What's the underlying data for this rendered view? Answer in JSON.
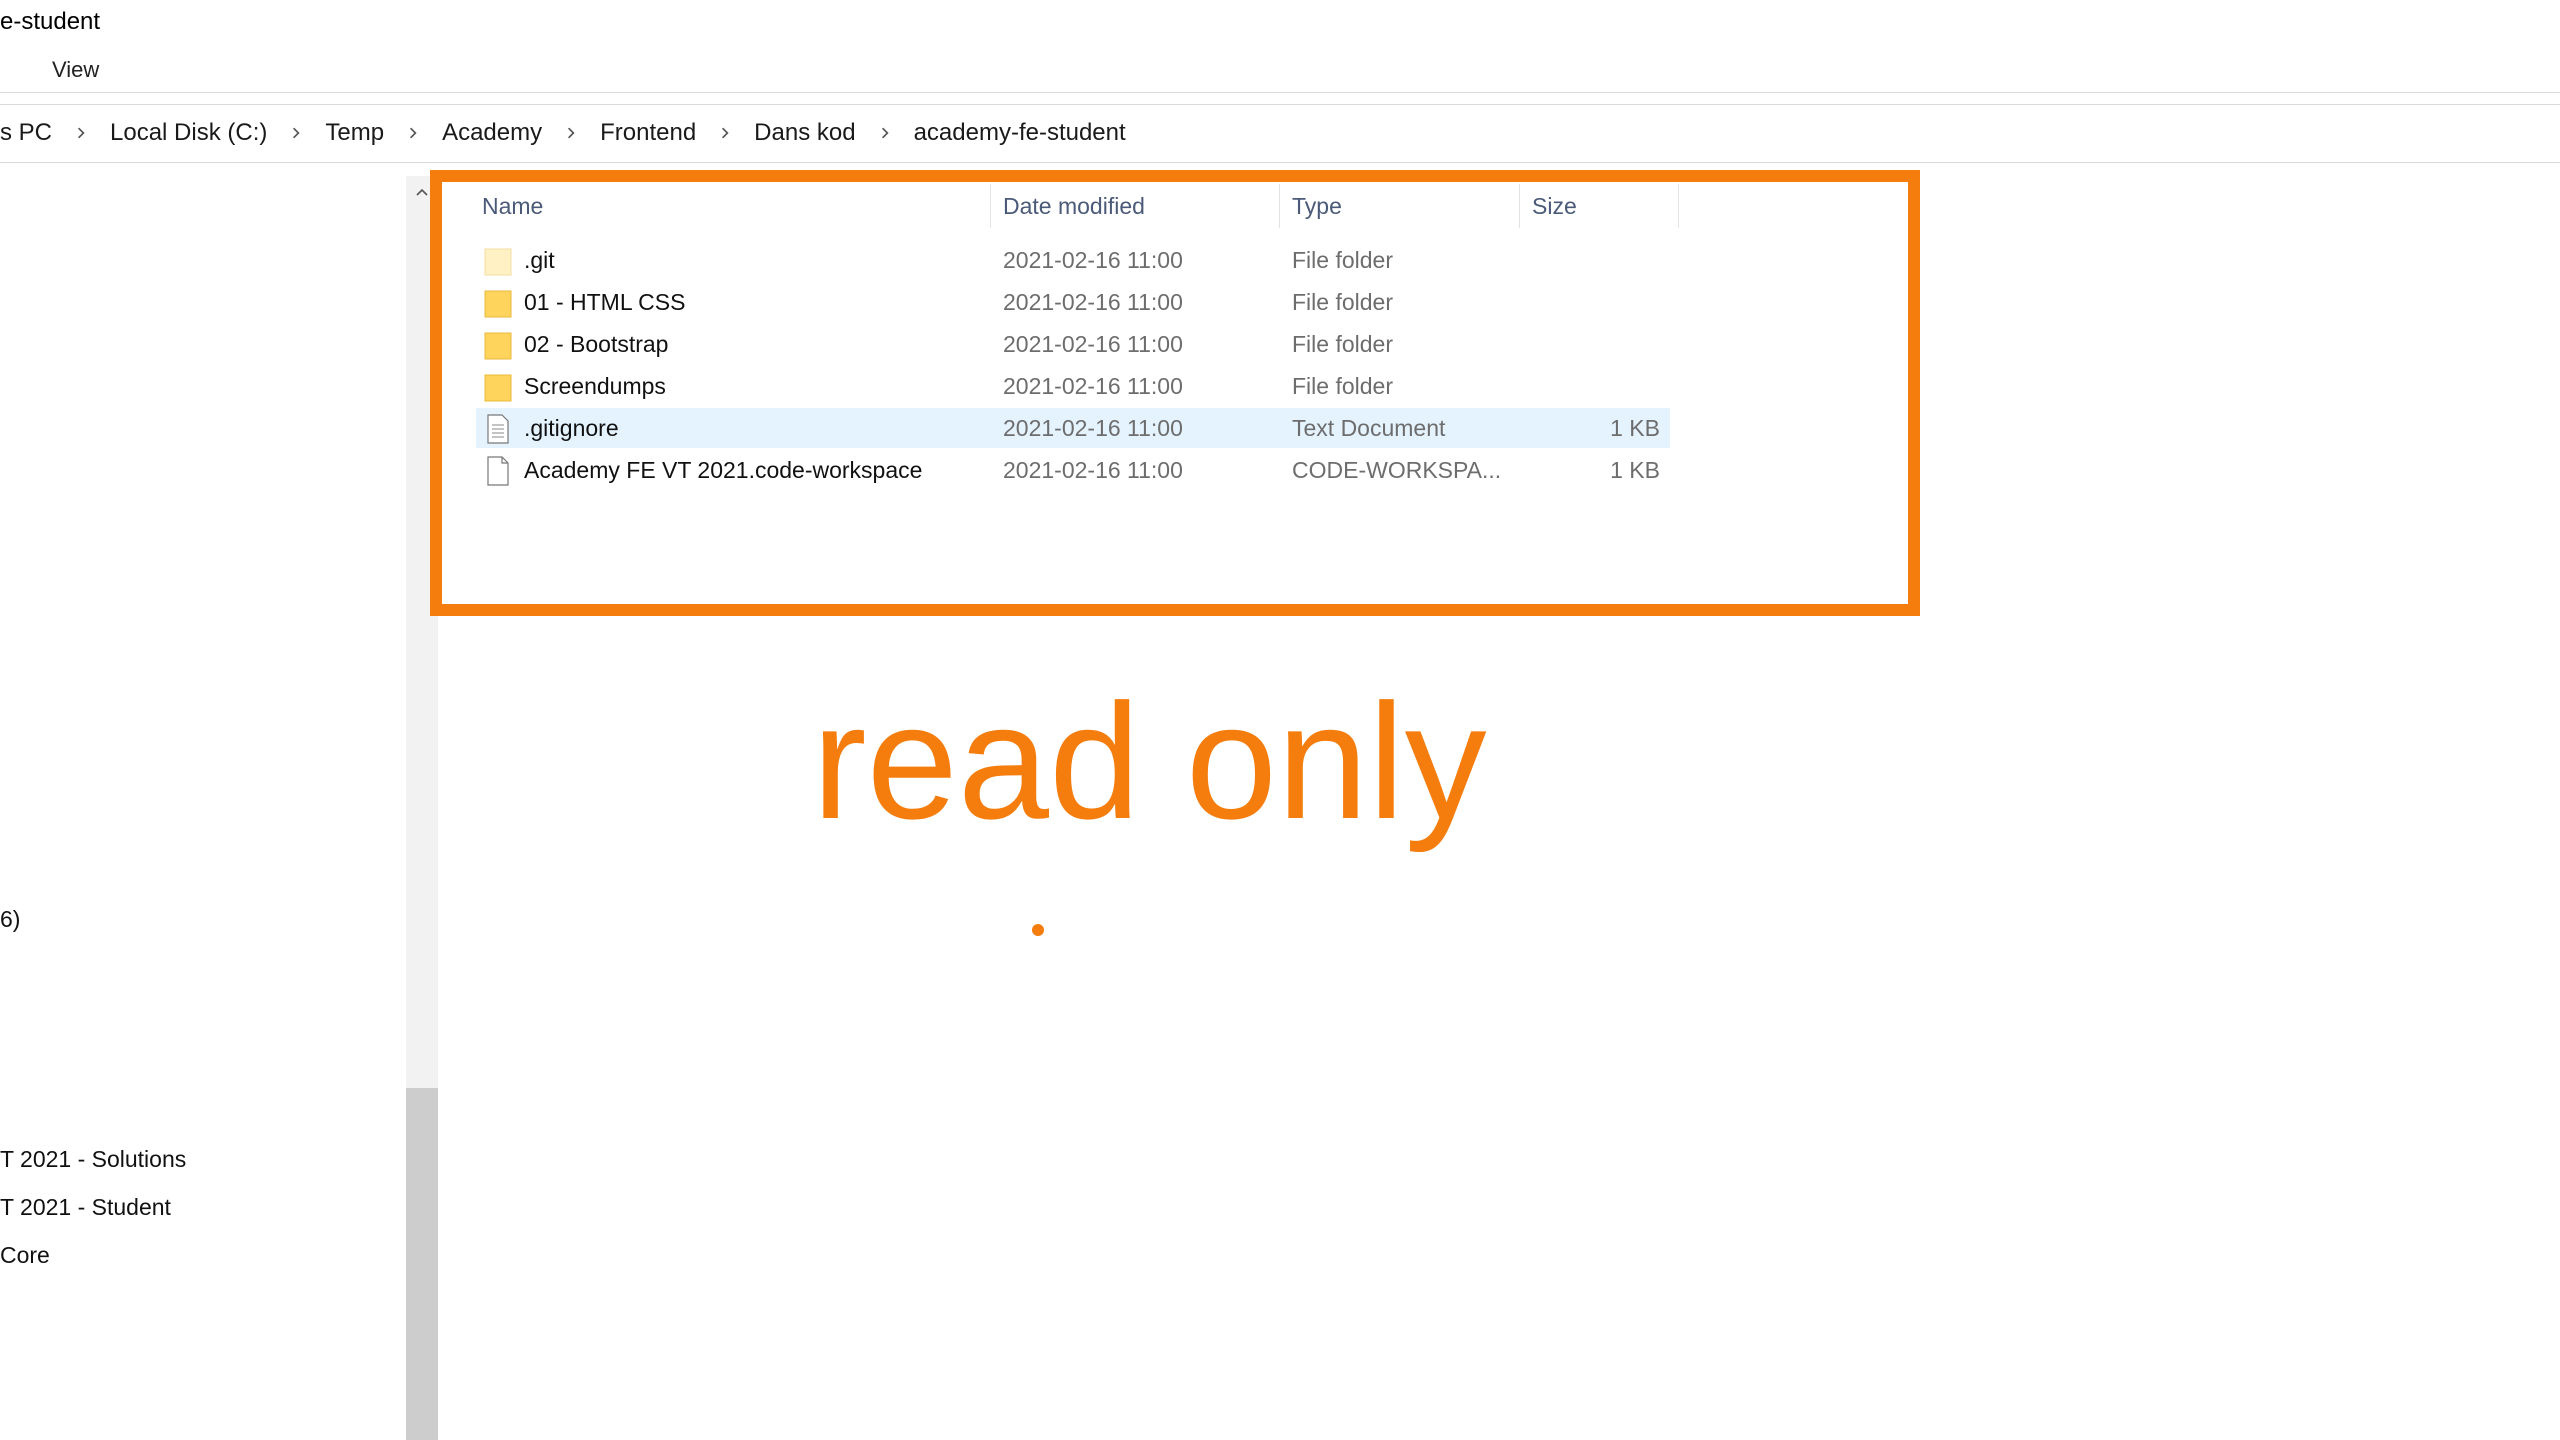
{
  "window": {
    "title": "e-student"
  },
  "ribbon": {
    "view_label": "View"
  },
  "breadcrumb": [
    "s PC",
    "Local Disk (C:)",
    "Temp",
    "Academy",
    "Frontend",
    "Dans kod",
    "academy-fe-student"
  ],
  "nav_pane": {
    "items": [
      {
        "label": "6)"
      },
      {
        "label": "T 2021 - Solutions"
      },
      {
        "label": "T 2021 - Student"
      },
      {
        "label": "Core"
      }
    ]
  },
  "file_list": {
    "columns": {
      "name": "Name",
      "date": "Date modified",
      "type": "Type",
      "size": "Size"
    },
    "rows": [
      {
        "name": ".git",
        "date": "2021-02-16 11:00",
        "type": "File folder",
        "size": "",
        "icon": "folder-faded-icon",
        "selected": false
      },
      {
        "name": "01 - HTML CSS",
        "date": "2021-02-16 11:00",
        "type": "File folder",
        "size": "",
        "icon": "folder-icon",
        "selected": false
      },
      {
        "name": "02 - Bootstrap",
        "date": "2021-02-16 11:00",
        "type": "File folder",
        "size": "",
        "icon": "folder-icon",
        "selected": false
      },
      {
        "name": "Screendumps",
        "date": "2021-02-16 11:00",
        "type": "File folder",
        "size": "",
        "icon": "folder-icon",
        "selected": false
      },
      {
        "name": ".gitignore",
        "date": "2021-02-16 11:00",
        "type": "Text Document",
        "size": "1 KB",
        "icon": "text-file-icon",
        "selected": true
      },
      {
        "name": "Academy FE VT 2021.code-workspace",
        "date": "2021-02-16 11:00",
        "type": "CODE-WORKSPA...",
        "size": "1 KB",
        "icon": "file-icon",
        "selected": false
      }
    ]
  },
  "annotation": {
    "text": "read only",
    "color": "#f57d0d"
  },
  "colors": {
    "selection": "#e5f3ff",
    "folder": "#ffd45c",
    "header_text": "#4a5a78"
  }
}
